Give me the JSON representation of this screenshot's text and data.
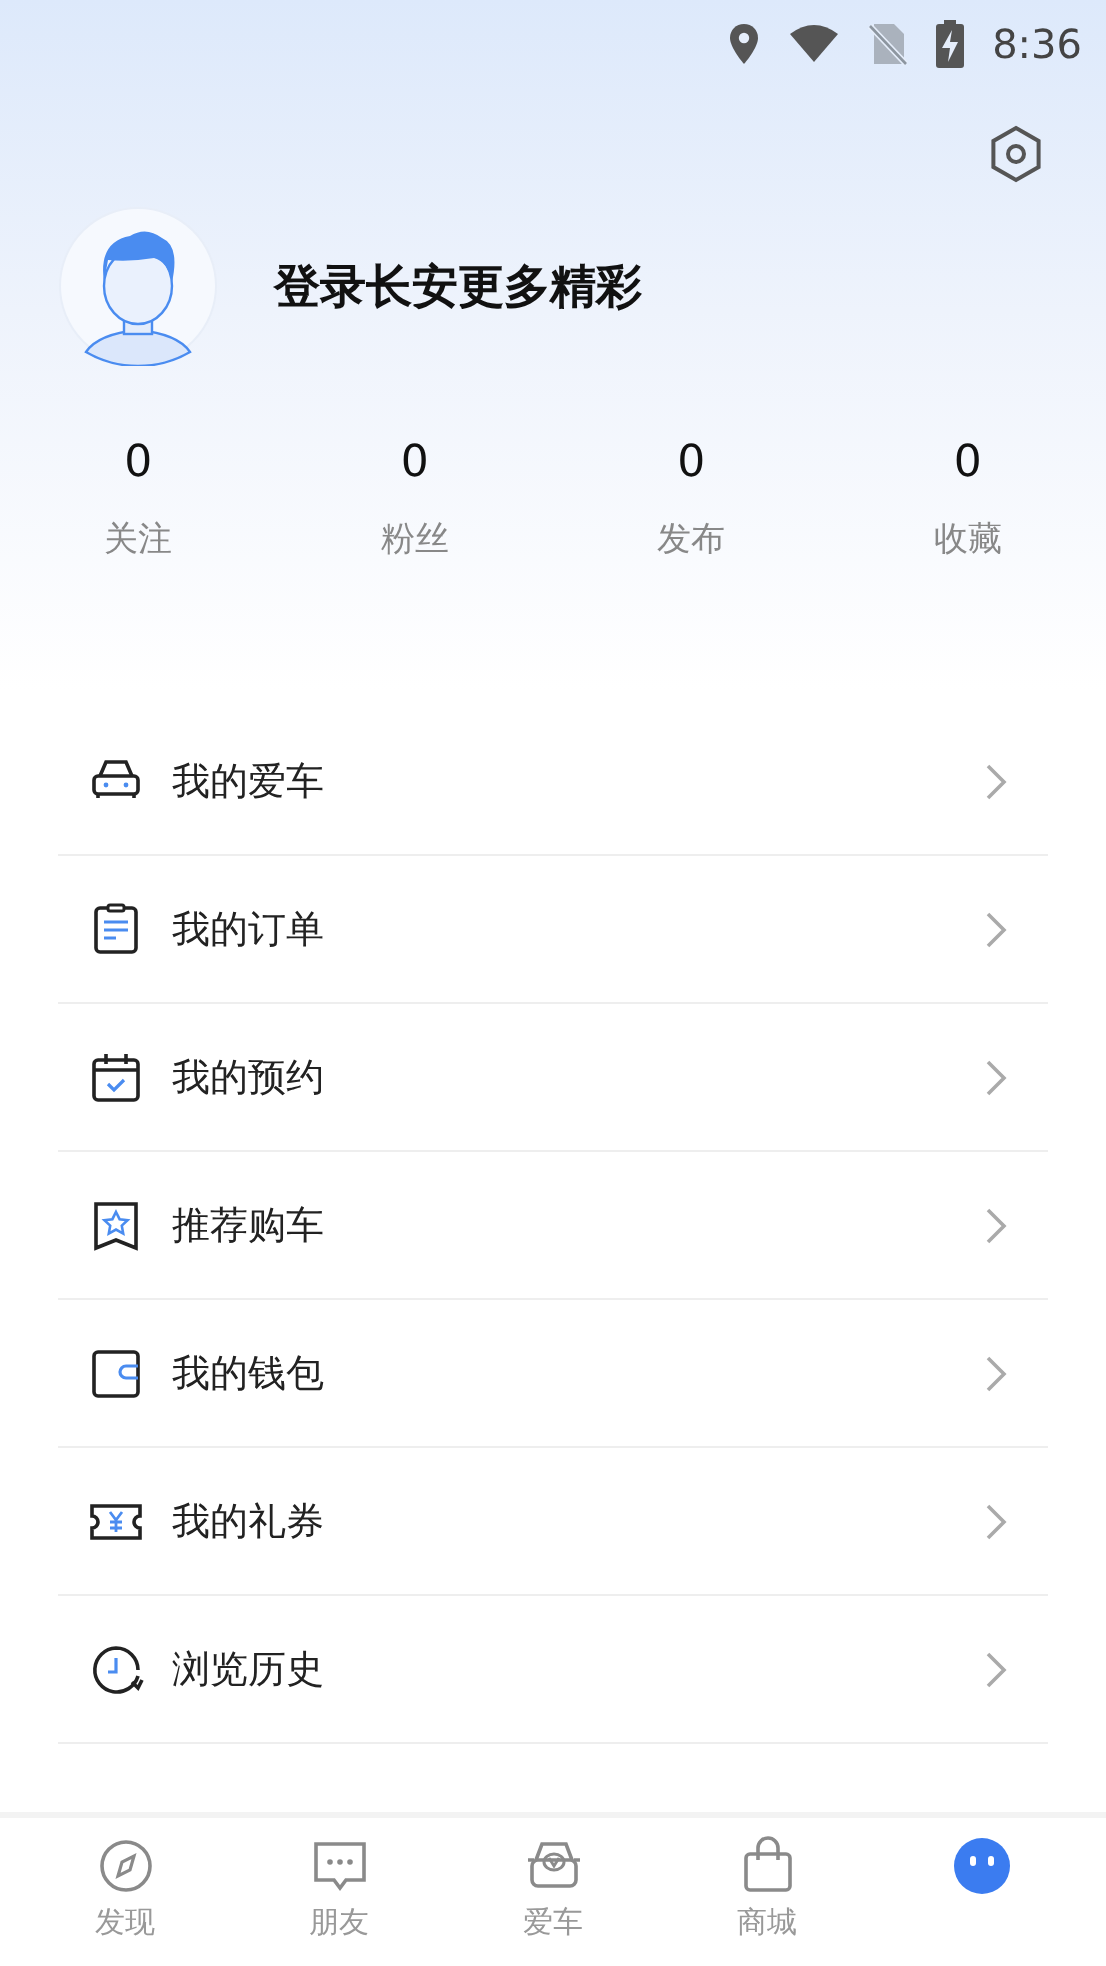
{
  "status_bar": {
    "time": "8:36"
  },
  "profile": {
    "prompt": "登录长安更多精彩"
  },
  "stats": [
    {
      "count": "0",
      "label": "关注"
    },
    {
      "count": "0",
      "label": "粉丝"
    },
    {
      "count": "0",
      "label": "发布"
    },
    {
      "count": "0",
      "label": "收藏"
    }
  ],
  "menu": [
    {
      "kind": "car",
      "label": "我的爱车"
    },
    {
      "kind": "order",
      "label": "我的订单"
    },
    {
      "kind": "booking",
      "label": "我的预约"
    },
    {
      "kind": "recommend",
      "label": "推荐购车"
    },
    {
      "kind": "wallet",
      "label": "我的钱包"
    },
    {
      "kind": "coupon",
      "label": "我的礼券"
    },
    {
      "kind": "history",
      "label": "浏览历史"
    }
  ],
  "tab_bar": [
    {
      "kind": "discover",
      "label": "发现",
      "selected": false
    },
    {
      "kind": "friends",
      "label": "朋友",
      "selected": false
    },
    {
      "kind": "car",
      "label": "爱车",
      "selected": false
    },
    {
      "kind": "shop",
      "label": "商城",
      "selected": false
    },
    {
      "kind": "me",
      "selected": true
    }
  ]
}
